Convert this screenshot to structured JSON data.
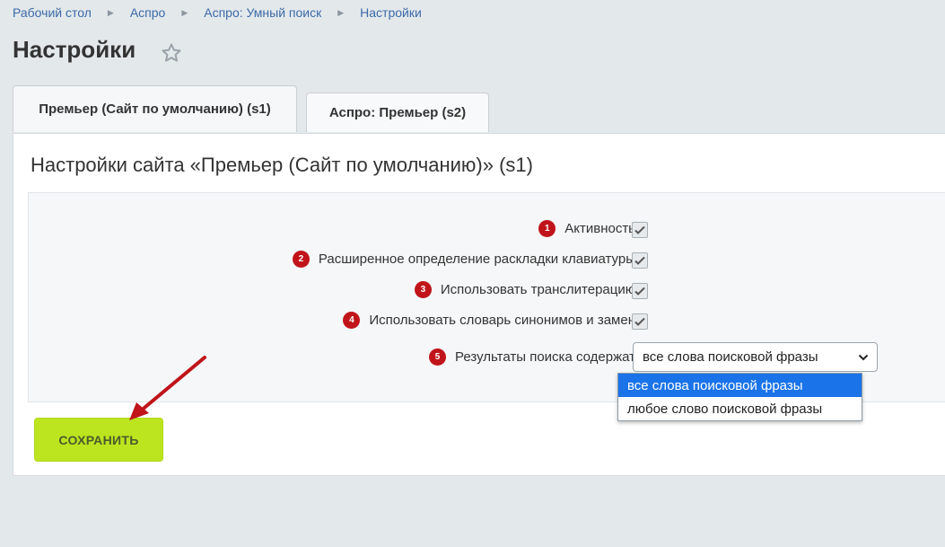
{
  "breadcrumb": [
    "Рабочий стол",
    "Аспро",
    "Аспро: Умный поиск",
    "Настройки"
  ],
  "page": {
    "title": "Настройки"
  },
  "tabs": [
    {
      "label": "Премьер (Сайт по умолчанию) (s1)",
      "active": true
    },
    {
      "label": "Аспро: Премьер (s2)",
      "active": false
    }
  ],
  "panel": {
    "title": "Настройки сайта «Премьер (Сайт по умолчанию)» (s1)"
  },
  "settings": [
    {
      "num": "1",
      "label": "Активность",
      "checked": true
    },
    {
      "num": "2",
      "label": "Расширенное определение раскладки клавиатуры",
      "checked": true
    },
    {
      "num": "3",
      "label": "Использовать транслитерацию",
      "checked": true
    },
    {
      "num": "4",
      "label": "Использовать словарь синонимов и замен",
      "checked": true
    }
  ],
  "search_results": {
    "num": "5",
    "label": "Результаты поиска содержат",
    "value": "все слова поисковой фразы",
    "options": [
      "все слова поисковой фразы",
      "любое слово поисковой фразы"
    ]
  },
  "save_label": "СОХРАНИТЬ",
  "colors": {
    "badge": "#c0141a",
    "save": "#bde51f",
    "arrow": "#c0141a",
    "selected_option": "#1a73e8"
  }
}
